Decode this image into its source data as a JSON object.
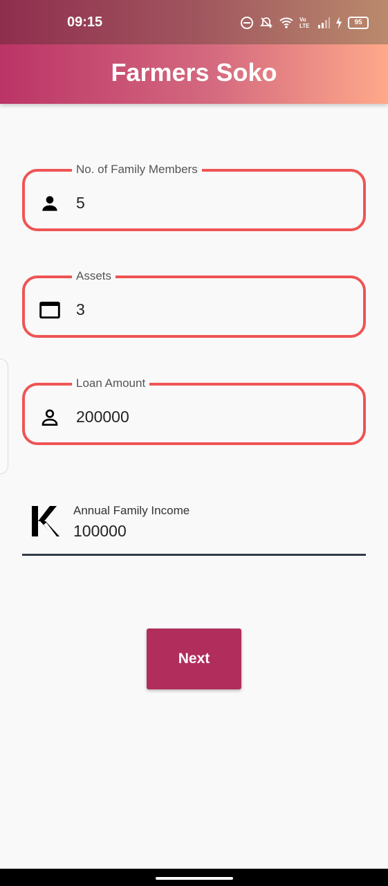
{
  "status_bar": {
    "time": "09:15",
    "battery": "95",
    "network": "Vo LTE",
    "icons": [
      "do-not-disturb-icon",
      "bell-off-icon",
      "wifi-icon",
      "signal-icon",
      "charging-icon",
      "battery-icon"
    ]
  },
  "app_bar": {
    "title": "Farmers Soko"
  },
  "form": {
    "family_members": {
      "label": "No. of Family Members",
      "value": "5",
      "icon": "person-icon"
    },
    "assets": {
      "label": "Assets",
      "value": "3",
      "icon": "window-icon"
    },
    "loan_amount": {
      "label": "Loan Amount",
      "value": "200000",
      "icon": "person-outline-icon"
    },
    "annual_income": {
      "label": "Annual Family Income",
      "value": "100000",
      "icon": "k-logo-icon"
    }
  },
  "actions": {
    "next_label": "Next"
  },
  "colors": {
    "field_border": "#ef5454",
    "button": "#b12e5c",
    "appbar_start": "#bb3466",
    "appbar_end": "#ffa98a"
  }
}
